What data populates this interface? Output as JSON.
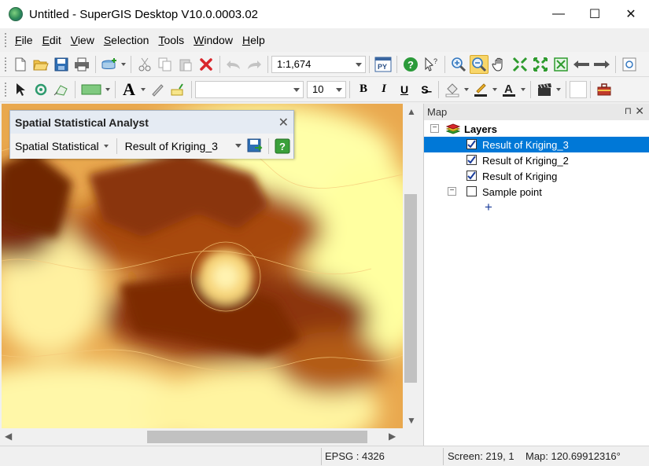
{
  "window": {
    "title": "Untitled - SuperGIS Desktop V10.0.0003.02",
    "minimize": "—",
    "maximize": "☐",
    "close": "✕"
  },
  "menu": [
    {
      "label": "File",
      "key": "F",
      "rest": "ile"
    },
    {
      "label": "Edit",
      "key": "E",
      "rest": "dit"
    },
    {
      "label": "View",
      "key": "V",
      "rest": "iew"
    },
    {
      "label": "Selection",
      "key": "S",
      "rest": "election"
    },
    {
      "label": "Tools",
      "key": "T",
      "rest": "ools"
    },
    {
      "label": "Window",
      "key": "W",
      "rest": "indow"
    },
    {
      "label": "Help",
      "key": "H",
      "rest": "elp"
    }
  ],
  "toolbar": {
    "scale_value": "1:1,674",
    "python_label": "PY",
    "font_size_value": "10",
    "bold": "B",
    "italic": "I",
    "underline": "U",
    "strike": "S̶",
    "text_tool": "A",
    "font_color_letter": "A"
  },
  "analyst": {
    "title": "Spatial Statistical Analyst",
    "close": "✕",
    "menu_label": "Spatial Statistical",
    "layer_value": "Result of Kriging_3"
  },
  "map_panel": {
    "title": "Map",
    "pin": "⊓",
    "close": "✕",
    "root_label": "Layers",
    "layers": [
      {
        "label": "Result of Kriging_3",
        "checked": true,
        "selected": true
      },
      {
        "label": "Result of Kriging_2",
        "checked": true,
        "selected": false
      },
      {
        "label": "Result of Kriging",
        "checked": true,
        "selected": false
      },
      {
        "label": "Sample point",
        "checked": false,
        "selected": false
      }
    ],
    "symbol": "+"
  },
  "status": {
    "epsg": "EPSG : 4326",
    "screen": "Screen: 219, 1",
    "map": "Map: 120.69912316°"
  },
  "colors": {
    "selection": "#0078d7",
    "raster_low": "#ffffa8",
    "raster_mid": "#e8a440",
    "raster_high": "#7a2a0a"
  }
}
